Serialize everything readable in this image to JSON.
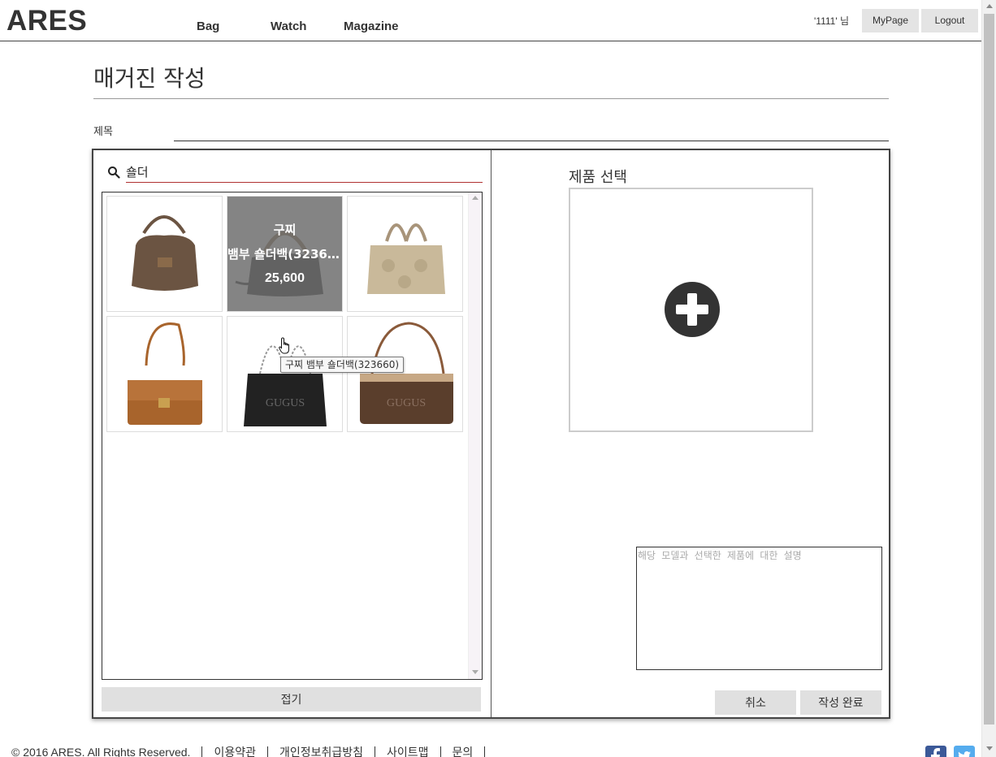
{
  "header": {
    "logo": "ARES",
    "nav": [
      "Bag",
      "Watch",
      "Magazine"
    ],
    "user_greeting": "'1111' 님",
    "mypage_label": "MyPage",
    "logout_label": "Logout"
  },
  "page": {
    "title": "매거진 작성",
    "title_field_label": "제목",
    "title_field_value": ""
  },
  "search": {
    "icon": "search-icon",
    "query": "숄더"
  },
  "results": [
    {
      "name": "bag-brown-suede-hobo",
      "color": "#6b5442"
    },
    {
      "name": "bag-black-bamboo-shoulder",
      "color": "#1e1e1e",
      "hovered": true,
      "brand": "구찌",
      "product": "뱀부 숄더백(323660)",
      "price": "25,600",
      "tooltip": "구찌 뱀부 숄더백(323660)"
    },
    {
      "name": "bag-beige-signature-tote",
      "color": "#c9b99a"
    },
    {
      "name": "bag-tan-leather-flap",
      "color": "#a8642c"
    },
    {
      "name": "bag-black-chain-tote",
      "color": "#222222"
    },
    {
      "name": "bag-brown-canvas-pochette",
      "color": "#5a3e2c"
    }
  ],
  "fold_label": "접기",
  "product_select": {
    "label": "제품 선택",
    "icon": "plus-circle-icon"
  },
  "description_placeholder": "해당 모델과 선택한 제품에 대한 설명",
  "buttons": {
    "cancel": "취소",
    "submit": "작성 완료"
  },
  "footer": {
    "copyright": "© 2016 ARES. All Rights Reserved.",
    "links": [
      "이용약관",
      "개인정보취급방침",
      "사이트맵",
      "문의"
    ],
    "social": [
      "facebook-icon",
      "twitter-icon"
    ]
  },
  "colors": {
    "accent_underline": "#b03030",
    "overlay": "#6e6e6e",
    "button_bg": "#e0e0e0",
    "plus_icon": "#333333",
    "facebook": "#3b5998",
    "twitter": "#55acee"
  }
}
